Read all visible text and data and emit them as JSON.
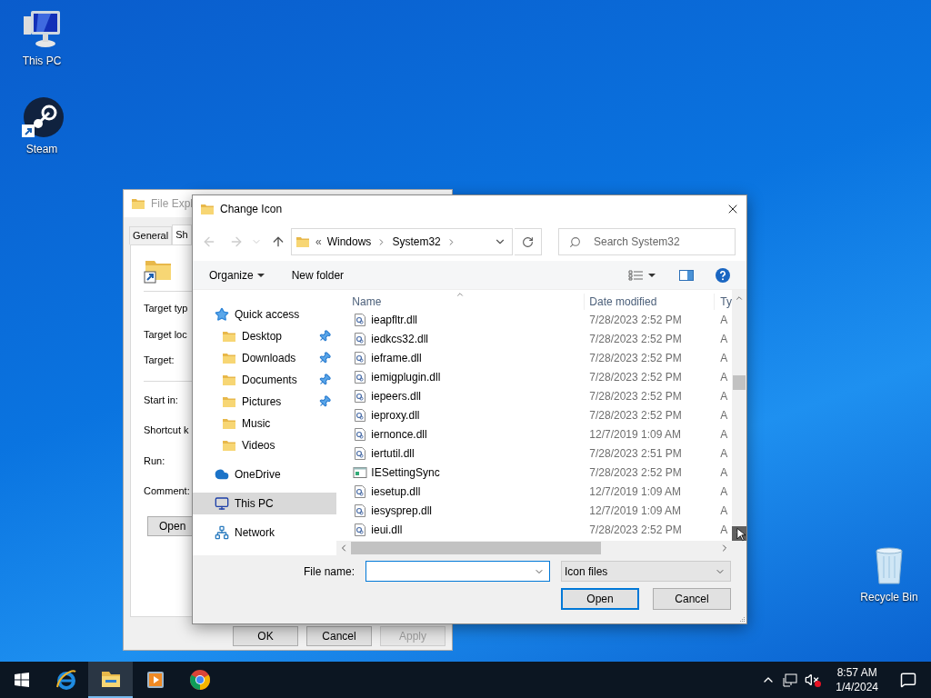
{
  "desktop_icons": [
    {
      "label": "This PC",
      "kind": "computer"
    },
    {
      "label": "Steam",
      "kind": "steam"
    },
    {
      "label": "Recycle Bin",
      "kind": "recycle"
    }
  ],
  "properties_window": {
    "title": "File Expl",
    "tabs": [
      {
        "label": "General",
        "selected": false
      },
      {
        "label": "Sh",
        "selected": true
      }
    ],
    "fields_top": [
      "Target typ",
      "Target loc",
      "Target:"
    ],
    "fields_bottom": [
      "Start in:",
      "Shortcut k",
      "Run:",
      "Comment:"
    ],
    "open_button": "Open",
    "buttons": [
      {
        "label": "OK",
        "disabled": false
      },
      {
        "label": "Cancel",
        "disabled": false
      },
      {
        "label": "Apply",
        "disabled": true
      }
    ]
  },
  "dialog": {
    "title": "Change Icon",
    "address": {
      "overflow_glyph": "«",
      "crumbs": [
        "Windows",
        "System32"
      ]
    },
    "search": {
      "placeholder": "Search System32"
    },
    "toolbar": {
      "organize": "Organize",
      "new_folder": "New folder"
    },
    "nav": [
      {
        "label": "Quick access",
        "kind": "star",
        "selected": false,
        "children": [
          {
            "label": "Desktop",
            "kind": "folder",
            "pinned": true,
            "selected": false
          },
          {
            "label": "Downloads",
            "kind": "folder",
            "pinned": true,
            "selected": false
          },
          {
            "label": "Documents",
            "kind": "folder",
            "pinned": true,
            "selected": false
          },
          {
            "label": "Pictures",
            "kind": "folder",
            "pinned": true,
            "selected": false
          },
          {
            "label": "Music",
            "kind": "folder",
            "pinned": false,
            "selected": false
          },
          {
            "label": "Videos",
            "kind": "folder",
            "pinned": false,
            "selected": false
          }
        ]
      },
      {
        "label": "OneDrive",
        "kind": "cloud",
        "selected": false
      },
      {
        "label": "This PC",
        "kind": "pc",
        "selected": true
      },
      {
        "label": "Network",
        "kind": "network",
        "selected": false
      }
    ],
    "columns": [
      "Name",
      "Date modified",
      "Ty"
    ],
    "files": [
      {
        "name": "ieapfltr.dll",
        "date": "7/28/2023 2:52 PM",
        "type": "A",
        "kind": "dll"
      },
      {
        "name": "iedkcs32.dll",
        "date": "7/28/2023 2:52 PM",
        "type": "A",
        "kind": "dll"
      },
      {
        "name": "ieframe.dll",
        "date": "7/28/2023 2:52 PM",
        "type": "A",
        "kind": "dll"
      },
      {
        "name": "iemigplugin.dll",
        "date": "7/28/2023 2:52 PM",
        "type": "A",
        "kind": "dll"
      },
      {
        "name": "iepeers.dll",
        "date": "7/28/2023 2:52 PM",
        "type": "A",
        "kind": "dll"
      },
      {
        "name": "ieproxy.dll",
        "date": "7/28/2023 2:52 PM",
        "type": "A",
        "kind": "dll"
      },
      {
        "name": "iernonce.dll",
        "date": "12/7/2019 1:09 AM",
        "type": "A",
        "kind": "dll"
      },
      {
        "name": "iertutil.dll",
        "date": "7/28/2023 2:51 PM",
        "type": "A",
        "kind": "dll"
      },
      {
        "name": "IESettingSync",
        "date": "7/28/2023 2:52 PM",
        "type": "A",
        "kind": "exe"
      },
      {
        "name": "iesetup.dll",
        "date": "12/7/2019 1:09 AM",
        "type": "A",
        "kind": "dll"
      },
      {
        "name": "iesysprep.dll",
        "date": "12/7/2019 1:09 AM",
        "type": "A",
        "kind": "dll"
      },
      {
        "name": "ieui.dll",
        "date": "7/28/2023 2:52 PM",
        "type": "A",
        "kind": "dll"
      }
    ],
    "file_name": {
      "label": "File name:"
    },
    "file_type": "Icon files",
    "buttons": [
      {
        "label": "Open",
        "default": true
      },
      {
        "label": "Cancel",
        "default": false
      }
    ]
  },
  "taskbar": {
    "apps": [
      {
        "kind": "ie",
        "selected": false
      },
      {
        "kind": "explorer",
        "selected": true
      },
      {
        "kind": "media",
        "selected": false
      },
      {
        "kind": "chrome",
        "selected": false
      }
    ],
    "time": "8:57 AM",
    "date": "1/4/2024"
  }
}
